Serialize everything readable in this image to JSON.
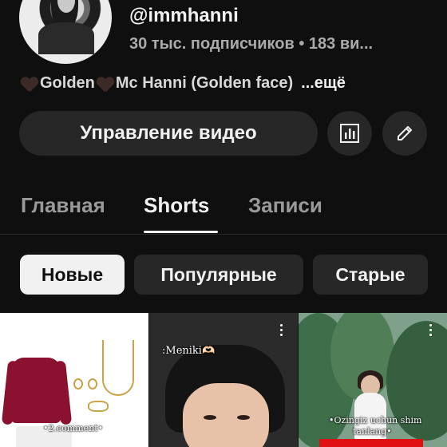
{
  "channel": {
    "handle": "@immhanni",
    "stats": "30 тыс. подписчиков • 183 ви...",
    "description": "Golden",
    "description_mid": " Mc Hanni (Golden face)",
    "description_more": "...ещё"
  },
  "actions": {
    "manage_videos": "Управление видео",
    "stats_icon": "bar-chart-icon",
    "edit_icon": "pencil-icon"
  },
  "tabs": [
    {
      "label": "Главная",
      "active": false
    },
    {
      "label": "Shorts",
      "active": true
    },
    {
      "label": "Записи",
      "active": false
    }
  ],
  "filters": [
    {
      "label": "Новые",
      "selected": true
    },
    {
      "label": "Популярные",
      "selected": false
    },
    {
      "label": "Старые",
      "selected": false
    }
  ],
  "shorts": [
    {
      "caption": "•2.comment•"
    },
    {
      "caption": ":Meniki🫶🏻"
    },
    {
      "caption_line1": "•Ozingiz uchun shim",
      "caption_line2": "tanlang•"
    }
  ],
  "colors": {
    "background": "#0f0f0f",
    "surface": "#272727",
    "text": "#f1f1f1",
    "muted": "#aaaaaa"
  }
}
